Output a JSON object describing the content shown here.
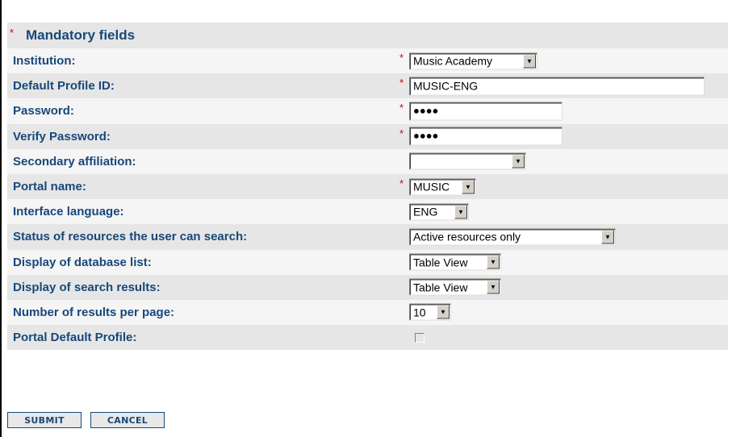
{
  "header": {
    "required_marker": "*",
    "title": "Mandatory fields"
  },
  "fields": [
    {
      "label": "Institution:",
      "required": true,
      "type": "select",
      "value": "Music Academy"
    },
    {
      "label": "Default Profile ID:",
      "required": true,
      "type": "text",
      "value": "MUSIC-ENG"
    },
    {
      "label": "Password:",
      "required": true,
      "type": "password",
      "value": "●●●●"
    },
    {
      "label": "Verify Password:",
      "required": true,
      "type": "password",
      "value": "●●●●"
    },
    {
      "label": "Secondary affiliation:",
      "required": false,
      "type": "select",
      "value": ""
    },
    {
      "label": "Portal name:",
      "required": true,
      "type": "select",
      "value": "MUSIC"
    },
    {
      "label": "Interface language:",
      "required": false,
      "type": "select",
      "value": "ENG"
    },
    {
      "label": "Status of resources the user can search:",
      "required": false,
      "type": "select",
      "value": "Active resources only"
    },
    {
      "label": "Display of database list:",
      "required": false,
      "type": "select",
      "value": "Table View"
    },
    {
      "label": "Display of search results:",
      "required": false,
      "type": "select",
      "value": "Table View"
    },
    {
      "label": "Number of results per page:",
      "required": false,
      "type": "select",
      "value": "10"
    },
    {
      "label": "Portal Default Profile:",
      "required": false,
      "type": "checkbox",
      "checked": false
    }
  ],
  "buttons": {
    "submit": "SUBMIT",
    "cancel": "CANCEL"
  },
  "required_marker": "*",
  "dropdown_arrow": "▼",
  "colors": {
    "label": "#17487a",
    "required": "#cc0000",
    "panel": "#e6e6e6",
    "row_alt": "#f5f5f5"
  }
}
